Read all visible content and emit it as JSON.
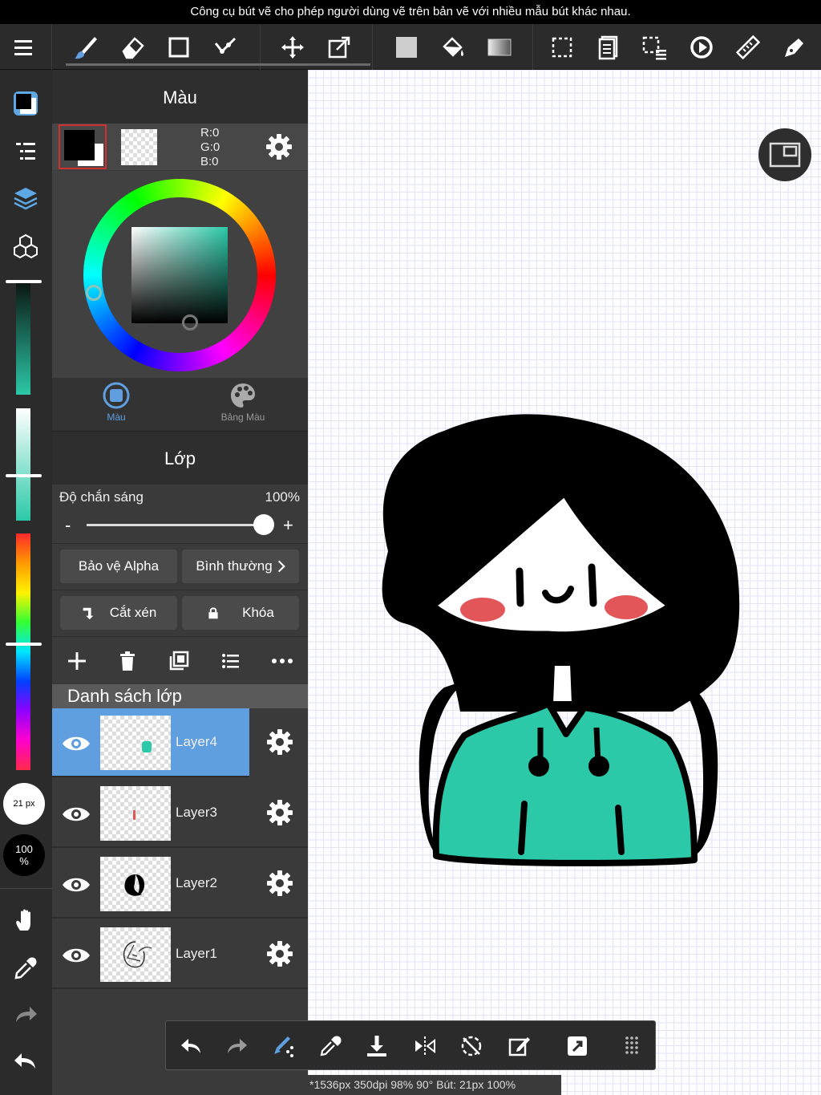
{
  "caption": "Công cụ bút vẽ cho phép người dùng vẽ trên bản vẽ với nhiều mẫu bút khác nhau.",
  "colors": {
    "accent": "#5f9fe0",
    "hair": "#000000",
    "hoodie": "#2bc9a8",
    "blush": "#e2565a"
  },
  "toolbar": {
    "tools": [
      "menu-icon",
      "brush-icon",
      "eraser-icon",
      "rect-icon",
      "connect-icon",
      "move-icon",
      "transform-icon",
      "fill-color-icon",
      "bucket-icon",
      "gradient-icon",
      "select-icon",
      "copy-layer-icon",
      "select-menu-icon",
      "rotate-icon",
      "ruler-icon",
      "pen-tool-icon"
    ]
  },
  "color_panel": {
    "title": "Màu",
    "rgb": {
      "r": "R:0",
      "g": "G:0",
      "b": "B:0"
    },
    "tabs": [
      {
        "label": "Màu",
        "icon": "color-circle-icon",
        "active": true
      },
      {
        "label": "Bảng Màu",
        "icon": "palette-icon",
        "active": false
      }
    ]
  },
  "layer_panel": {
    "title": "Lớp",
    "opacity_label": "Độ chắn sáng",
    "opacity_value": "100%",
    "opacity_fraction": 1.0,
    "minus": "-",
    "plus": "+",
    "protect_alpha": "Bảo vệ Alpha",
    "blend_mode": "Bình thường",
    "clip": "Cắt xén",
    "lock": "Khóa",
    "list_header": "Danh sách lớp",
    "layers": [
      {
        "name": "Layer4",
        "active": true
      },
      {
        "name": "Layer3",
        "active": false
      },
      {
        "name": "Layer2",
        "active": false
      },
      {
        "name": "Layer1",
        "active": false
      }
    ]
  },
  "left_sidebar": {
    "brush_size": "21 px",
    "opacity": "100\n%"
  },
  "bottom_tools": [
    "undo-icon",
    "redo-icon",
    "snap-icon",
    "eyedropper-icon",
    "download-icon",
    "flip-icon",
    "rotate-reset-icon",
    "edit-canvas-icon",
    "share-icon",
    "grid-icon"
  ],
  "status": "*1536px 350dpi 98% 90° Bút: 21px 100%"
}
